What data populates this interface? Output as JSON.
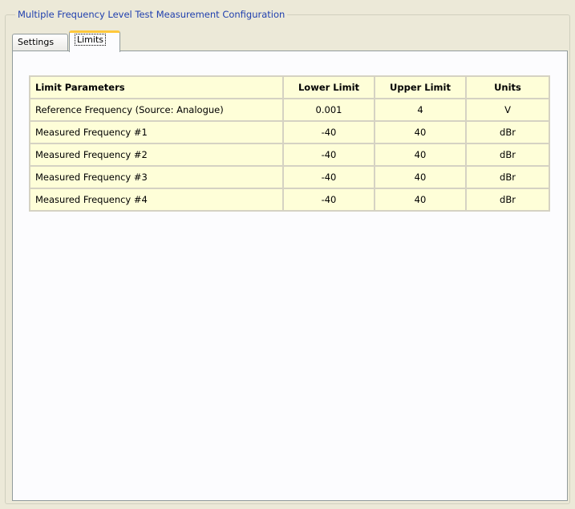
{
  "group": {
    "title": "Multiple Frequency Level Test Measurement Configuration"
  },
  "tabs": [
    {
      "label": "Settings",
      "selected": false
    },
    {
      "label": "Limits",
      "selected": true
    }
  ],
  "limits_table": {
    "headers": [
      "Limit Parameters",
      "Lower Limit",
      "Upper Limit",
      "Units"
    ],
    "rows": [
      [
        "Reference Frequency (Source: Analogue)",
        "0.001",
        "4",
        "V"
      ],
      [
        "Measured Frequency #1",
        "-40",
        "40",
        "dBr"
      ],
      [
        "Measured Frequency #2",
        "-40",
        "40",
        "dBr"
      ],
      [
        "Measured Frequency #3",
        "-40",
        "40",
        "dBr"
      ],
      [
        "Measured Frequency #4",
        "-40",
        "40",
        "dBr"
      ]
    ]
  },
  "colors": {
    "background": "#ece9d8",
    "group_title": "#1f3fae",
    "table_cell": "#fefed8",
    "table_border": "#d5d2c3",
    "tab_highlight": "#ffc83c"
  }
}
